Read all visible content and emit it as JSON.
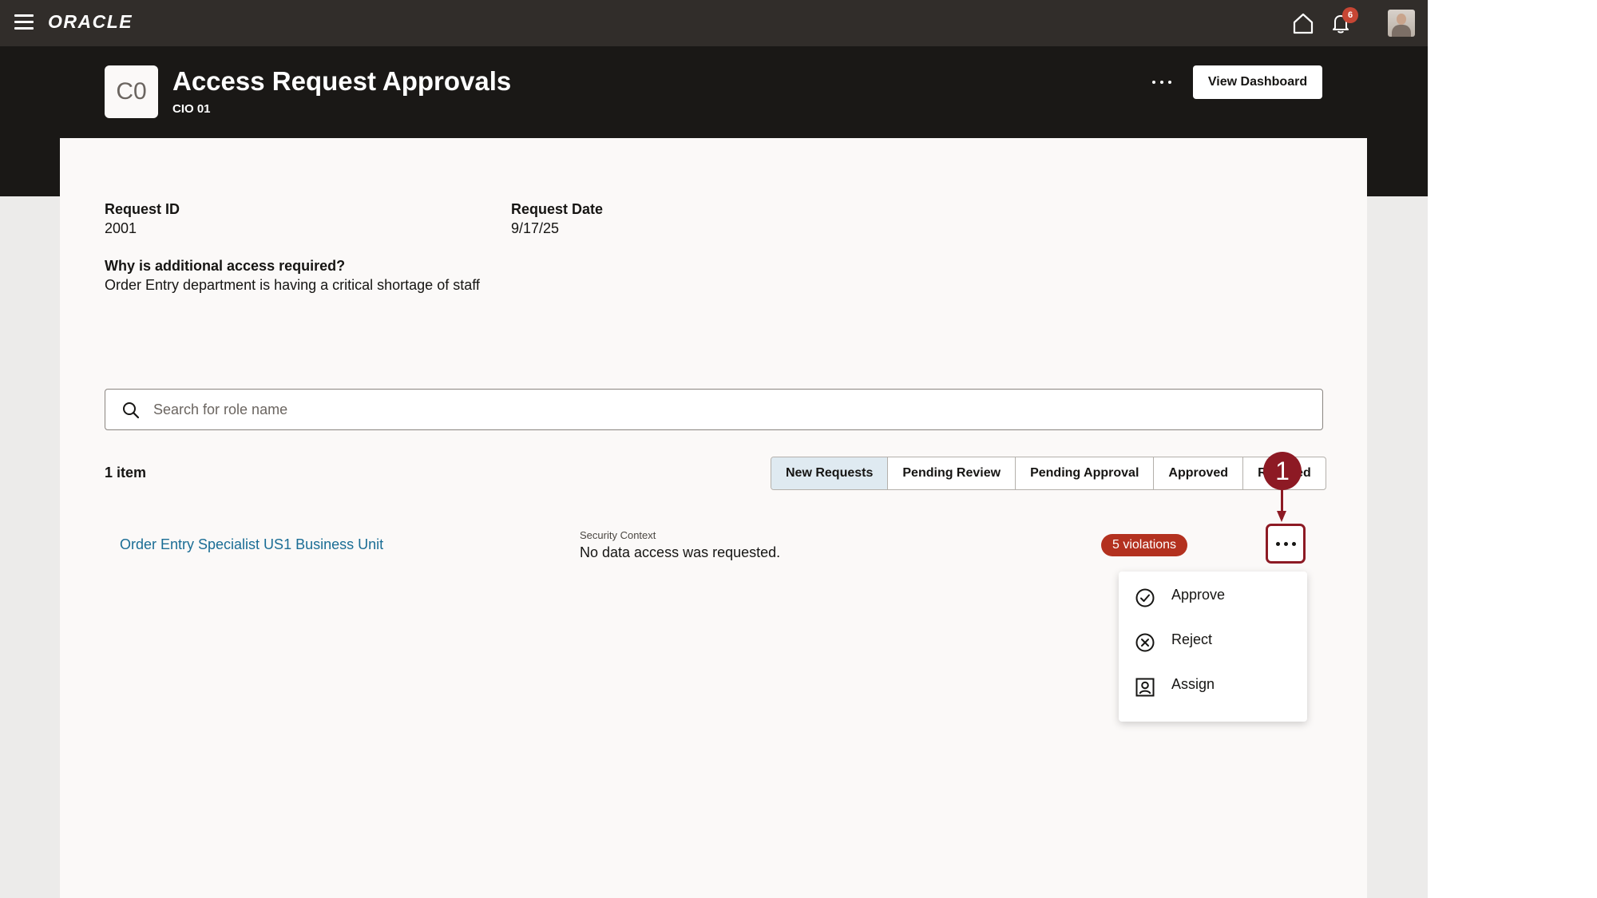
{
  "topbar": {
    "logo_text": "ORACLE",
    "notification_count": "6",
    "icons": [
      "hamburger-menu-icon",
      "home-icon",
      "bell-icon",
      "avatar"
    ]
  },
  "header": {
    "app_tile": "C0",
    "title": "Access Request Approvals",
    "subtitle": "CIO 01",
    "view_dashboard_label": "View Dashboard"
  },
  "request": {
    "id_label": "Request ID",
    "id_value": "2001",
    "date_label": "Request Date",
    "date_value": "9/17/25",
    "reason_label": "Why is additional access required?",
    "reason_value": "Order Entry department is having a critical shortage of staff"
  },
  "search": {
    "placeholder": "Search for role name",
    "value": ""
  },
  "list": {
    "count": "1 item",
    "tabs": [
      {
        "label": "New Requests",
        "active": true
      },
      {
        "label": "Pending Review",
        "active": false
      },
      {
        "label": "Pending Approval",
        "active": false
      },
      {
        "label": "Approved",
        "active": false
      },
      {
        "label": "Rejected",
        "active": false
      }
    ],
    "rows": [
      {
        "role": "Order Entry Specialist US1 Business Unit",
        "context_label": "Security Context",
        "context_value": "No data access was requested.",
        "violations": "5 violations"
      }
    ]
  },
  "action_menu": {
    "items": [
      {
        "label": "Approve",
        "icon": "check-circle-icon"
      },
      {
        "label": "Reject",
        "icon": "x-circle-icon"
      },
      {
        "label": "Assign",
        "icon": "assign-user-icon"
      }
    ]
  },
  "callout": {
    "number": "1"
  },
  "colors": {
    "topbar": "#312d2a",
    "hero": "#1a1816",
    "link": "#1a6d95",
    "violations_badge": "#b3311f",
    "callout": "#8d1a24",
    "active_tab": "#dfeaf1"
  }
}
